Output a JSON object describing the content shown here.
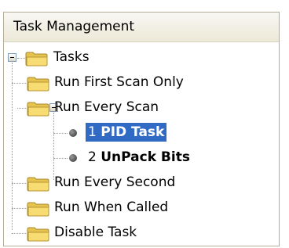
{
  "panel": {
    "title": "Task Management"
  },
  "tree": {
    "root": {
      "label": "Tasks",
      "icon": "folder-icon",
      "expanded": true
    },
    "children": [
      {
        "label": "Run First Scan Only",
        "icon": "folder-icon"
      },
      {
        "label": "Run Every Scan",
        "icon": "folder-icon",
        "expanded": true,
        "tasks": [
          {
            "number": "1",
            "name": "PID Task",
            "icon": "task-bullet-icon",
            "selected": true
          },
          {
            "number": "2",
            "name": "UnPack Bits",
            "icon": "task-bullet-icon",
            "selected": false
          }
        ]
      },
      {
        "label": "Run Every Second",
        "icon": "folder-icon"
      },
      {
        "label": "Run When Called",
        "icon": "folder-icon"
      },
      {
        "label": "Disable Task",
        "icon": "folder-icon"
      }
    ]
  },
  "colors": {
    "selection": "#316ac5",
    "header_bg": "#ece9d8",
    "folder": "#f3d66a"
  }
}
